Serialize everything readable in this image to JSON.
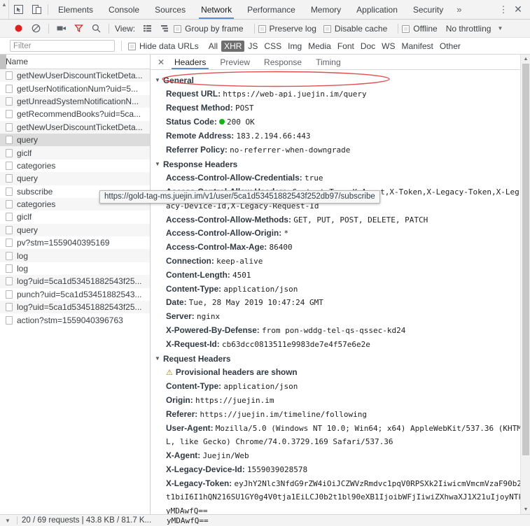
{
  "window": {
    "inspect_icon": "inspect-element-icon",
    "device_icon": "device-toolbar-icon",
    "more_icon": "more-tabs-chevron",
    "menu_icon": "kebab-menu-icon",
    "close_icon": "close-icon"
  },
  "main_tabs": [
    {
      "label": "Elements",
      "active": false
    },
    {
      "label": "Console",
      "active": false
    },
    {
      "label": "Sources",
      "active": false
    },
    {
      "label": "Network",
      "active": true
    },
    {
      "label": "Performance",
      "active": false
    },
    {
      "label": "Memory",
      "active": false
    },
    {
      "label": "Application",
      "active": false
    },
    {
      "label": "Security",
      "active": false
    }
  ],
  "main_tabs_overflow": "»",
  "toolbar": {
    "record_icon": "record-button-icon",
    "clear_icon": "clear-icon",
    "capture_screenshots_icon": "camera-icon",
    "filter_icon": "filter-funnel-icon",
    "search_icon": "search-icon",
    "view_label": "View:",
    "view_list_icon": "list-view-icon",
    "view_waterfall_icon": "waterfall-view-icon",
    "group_by_frame": "Group by frame",
    "preserve_log": "Preserve log",
    "disable_cache": "Disable cache",
    "offline": "Offline",
    "throttling": "No throttling",
    "throttling_caret": "▼"
  },
  "filter_row": {
    "placeholder": "Filter",
    "hide_data_urls": "Hide data URLs",
    "types": [
      {
        "label": "All",
        "selected": false
      },
      {
        "label": "XHR",
        "selected": true
      },
      {
        "label": "JS",
        "selected": false
      },
      {
        "label": "CSS",
        "selected": false
      },
      {
        "label": "Img",
        "selected": false
      },
      {
        "label": "Media",
        "selected": false
      },
      {
        "label": "Font",
        "selected": false
      },
      {
        "label": "Doc",
        "selected": false
      },
      {
        "label": "WS",
        "selected": false
      },
      {
        "label": "Manifest",
        "selected": false
      },
      {
        "label": "Other",
        "selected": false
      }
    ]
  },
  "request_list": {
    "column_header": "Name",
    "rows": [
      {
        "name": "getNewUserDiscountTicketDeta...",
        "selected": false
      },
      {
        "name": "getUserNotificationNum?uid=5...",
        "selected": false
      },
      {
        "name": "getUnreadSystemNotificationN...",
        "selected": false
      },
      {
        "name": "getRecommendBooks?uid=5ca...",
        "selected": false
      },
      {
        "name": "getNewUserDiscountTicketDeta...",
        "selected": false
      },
      {
        "name": "query",
        "selected": true
      },
      {
        "name": "giclf",
        "selected": false
      },
      {
        "name": "categories",
        "selected": false
      },
      {
        "name": "query",
        "selected": false
      },
      {
        "name": "subscribe",
        "selected": false
      },
      {
        "name": "categories",
        "selected": false
      },
      {
        "name": "giclf",
        "selected": false
      },
      {
        "name": "query",
        "selected": false
      },
      {
        "name": "pv?stm=1559040395169",
        "selected": false
      },
      {
        "name": "log",
        "selected": false
      },
      {
        "name": "log",
        "selected": false
      },
      {
        "name": "log?uid=5ca1d53451882543f25...",
        "selected": false
      },
      {
        "name": "punch?uid=5ca1d53451882543...",
        "selected": false
      },
      {
        "name": "log?uid=5ca1d53451882543f25...",
        "selected": false
      },
      {
        "name": "action?stm=1559040396763",
        "selected": false
      }
    ]
  },
  "detail_tabs": [
    {
      "label": "Headers",
      "active": true
    },
    {
      "label": "Preview",
      "active": false
    },
    {
      "label": "Response",
      "active": false
    },
    {
      "label": "Timing",
      "active": false
    }
  ],
  "detail_close": "✕",
  "sections": {
    "general": {
      "title": "General",
      "rows": [
        {
          "key": "Request URL:",
          "value": "https://web-api.juejin.im/query",
          "annotated": true
        },
        {
          "key": "Request Method:",
          "value": "POST"
        },
        {
          "key": "Status Code:",
          "value": "200 OK",
          "status": true
        },
        {
          "key": "Remote Address:",
          "value": "183.2.194.66:443"
        },
        {
          "key": "Referrer Policy:",
          "value": "no-referrer-when-downgrade"
        }
      ]
    },
    "response_headers": {
      "title": "Response Headers",
      "rows": [
        {
          "key": "Access-Control-Allow-Credentials:",
          "value": "true"
        },
        {
          "key": "Access-Control-Allow-Headers:",
          "value": "Content-Type,X-Agent,X-Token,X-Legacy-Token,X-Leg"
        },
        {
          "key": "",
          "value": "acy-Device-Id,X-Legacy-Request-Id",
          "continuation": true
        },
        {
          "key": "Access-Control-Allow-Methods:",
          "value": "GET, PUT, POST, DELETE, PATCH"
        },
        {
          "key": "Access-Control-Allow-Origin:",
          "value": "*"
        },
        {
          "key": "Access-Control-Max-Age:",
          "value": "86400"
        },
        {
          "key": "Connection:",
          "value": "keep-alive"
        },
        {
          "key": "Content-Length:",
          "value": "4501"
        },
        {
          "key": "Content-Type:",
          "value": "application/json"
        },
        {
          "key": "Date:",
          "value": "Tue, 28 May 2019 10:47:24 GMT"
        },
        {
          "key": "Server:",
          "value": "nginx"
        },
        {
          "key": "X-Powered-By-Defense:",
          "value": "from pon-wddg-tel-qs-qssec-kd24"
        },
        {
          "key": "X-Request-Id:",
          "value": "cb63dcc0813511e9983de7e4f57e6e2e"
        }
      ]
    },
    "request_headers": {
      "title": "Request Headers",
      "provisional_warning": "Provisional headers are shown",
      "warning_icon": "warning-triangle-icon",
      "rows": [
        {
          "key": "Content-Type:",
          "value": "application/json"
        },
        {
          "key": "Origin:",
          "value": "https://juejin.im"
        },
        {
          "key": "Referer:",
          "value": "https://juejin.im/timeline/following"
        },
        {
          "key": "User-Agent:",
          "value": "Mozilla/5.0 (Windows NT 10.0; Win64; x64) AppleWebKit/537.36 (KHTM"
        },
        {
          "key": "",
          "value": "L, like Gecko) Chrome/74.0.3729.169 Safari/537.36",
          "continuation": true
        },
        {
          "key": "X-Agent:",
          "value": "Juejin/Web"
        },
        {
          "key": "X-Legacy-Device-Id:",
          "value": "1559039028578"
        },
        {
          "key": "X-Legacy-Token:",
          "value": "eyJhY2Nlc3NfdG9rZW4iOiJCZWVzRmdvc1pqV0RPSXk2IiwicmVmcmVzaF90b2"
        },
        {
          "key": "",
          "value": "t1biI6I1hQN216SU1GY0g4V0tja1EiLCJ0b2t1bl90eXB1IjoibWFjIiwiZXhwaXJ1X21uIjoyNTk",
          "continuation": true
        },
        {
          "key": "",
          "value": "yMDAwfQ==",
          "continuation": true
        }
      ]
    }
  },
  "tooltip": {
    "text": "https://gold-tag-ms.juejin.im/v1/user/5ca1d53451882543f252db97/subscribe"
  },
  "annotation": {
    "color": "#e05050",
    "shape": "ellipse-around-request-url"
  },
  "status_bar": {
    "caret": "▼",
    "text": "20 / 69 requests  |  43.8 KB / 81.7 K..."
  },
  "colors": {
    "accent": "#5a8fd6",
    "status_ok": "#14b514",
    "filter_active": "#6e6e6e",
    "annotation_red": "#e05050"
  }
}
